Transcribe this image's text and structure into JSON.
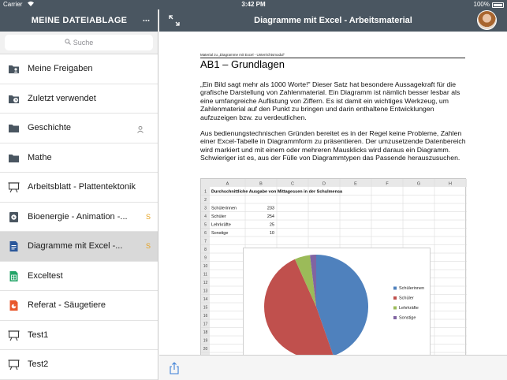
{
  "status": {
    "carrier": "Carrier",
    "time": "3:42 PM",
    "battery": "100%"
  },
  "sidebar": {
    "title": "MEINE DATEIABLAGE",
    "more": "...",
    "search_placeholder": "Suche",
    "items": [
      {
        "label": "Meine Freigaben",
        "icon": "shared-folder-icon"
      },
      {
        "label": "Zuletzt verwendet",
        "icon": "recent-folder-icon"
      },
      {
        "label": "Geschichte",
        "icon": "folder-icon",
        "shared": true
      },
      {
        "label": "Mathe",
        "icon": "folder-icon"
      },
      {
        "label": "Arbeitsblatt - Plattentektonik",
        "icon": "presentation-icon"
      },
      {
        "label": "Bioenergie - Animation -...",
        "icon": "video-icon",
        "badge": "S"
      },
      {
        "label": "Diagramme mit Excel -...",
        "icon": "word-document-icon",
        "badge": "S",
        "selected": true
      },
      {
        "label": "Exceltest",
        "icon": "spreadsheet-icon"
      },
      {
        "label": "Referat - Säugetiere",
        "icon": "slides-icon"
      },
      {
        "label": "Test1",
        "icon": "presentation-icon"
      },
      {
        "label": "Test2",
        "icon": "presentation-icon"
      }
    ]
  },
  "main": {
    "title": "Diagramme mit Excel - Arbeitsmaterial"
  },
  "document": {
    "meta": "Material zu „Diagramme mit Excel - Unterrichtsmodul\"",
    "heading": "AB1 – Grundlagen",
    "paragraph1": "„Ein Bild sagt mehr als 1000 Worte!\" Dieser Satz hat besondere Aussagekraft für die grafische Darstellung von Zahlenmaterial. Ein Diagramm ist nämlich besser lesbar als eine umfangreiche Auflistung von Ziffern. Es ist damit ein wichtiges Werkzeug, um Zahlenmaterial auf den Punkt zu bringen und darin enthaltene Entwicklungen aufzuzeigen bzw. zu verdeutlichen.",
    "paragraph2": "Aus bedienungstechnischen Gründen bereitet es in der Regel keine Probleme, Zahlen einer Excel-Tabelle in Diagrammform zu präsentieren. Der umzusetzende Datenbereich wird markiert und mit einem oder mehreren Mausklicks wird daraus ein Diagramm. Schwieriger ist es, aus der Fülle von Diagrammtypen das Passende herauszusuchen."
  },
  "spreadsheet": {
    "columns": [
      "A",
      "B",
      "C",
      "D",
      "E",
      "F",
      "G",
      "H"
    ],
    "rows": [
      "1",
      "2",
      "3",
      "4",
      "5",
      "6",
      "7",
      "8",
      "9",
      "10",
      "11",
      "12",
      "13",
      "14",
      "15",
      "16",
      "17",
      "18",
      "19",
      "20",
      "21"
    ],
    "title_cell": "Durchschnittliche Ausgabe von Mittagessen in der Schulmensa",
    "data": [
      {
        "label": "Schülerinnen",
        "value": "233"
      },
      {
        "label": "Schüler",
        "value": "254"
      },
      {
        "label": "Lehrkräfte",
        "value": "25"
      },
      {
        "label": "Sonstige",
        "value": "10"
      }
    ]
  },
  "chart_data": {
    "type": "pie",
    "categories": [
      "Schülerinnen",
      "Schüler",
      "Lehrkräfte",
      "Sonstige"
    ],
    "values": [
      233,
      254,
      25,
      10
    ],
    "colors": [
      "#4f81bd",
      "#c0504d",
      "#9bbb59",
      "#8064a2"
    ],
    "legend": "right"
  }
}
